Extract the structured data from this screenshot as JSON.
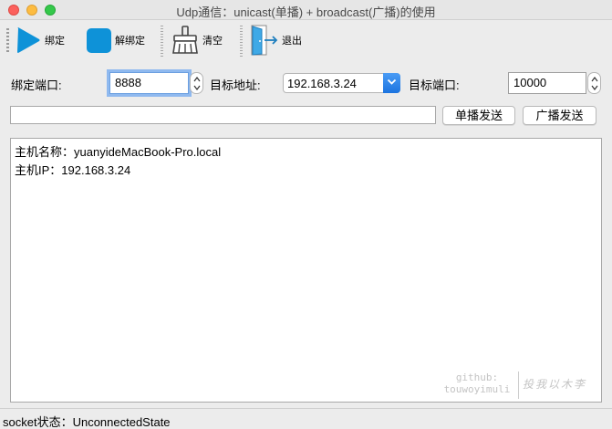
{
  "window": {
    "title": "Udp通信：unicast(单播) + broadcast(广播)的使用"
  },
  "toolbar": {
    "bind_label": "绑定",
    "unbind_label": "解绑定",
    "clear_label": "清空",
    "exit_label": "退出"
  },
  "form": {
    "bind_port_label": "绑定端口:",
    "bind_port_value": "8888",
    "target_addr_label": "目标地址:",
    "target_addr_value": "192.168.3.24",
    "target_port_label": "目标端口:",
    "target_port_value": "10000",
    "message_value": "",
    "unicast_button": "单播发送",
    "broadcast_button": "广播发送"
  },
  "log": {
    "lines": [
      "主机名称：yuanyideMacBook-Pro.local",
      "主机IP：192.168.3.24"
    ]
  },
  "watermark": {
    "left_line1": "github:",
    "left_line2": "touwoyimuli",
    "right": "投我以木李"
  },
  "status": {
    "text": "socket状态：UnconnectedState"
  },
  "colors": {
    "accent": "#1c74e0",
    "icon_blue": "#0e92d8"
  },
  "icons": [
    "play-icon",
    "stop-icon",
    "broom-icon",
    "exit-door-icon",
    "chevron-down-icon",
    "stepper-icon"
  ]
}
